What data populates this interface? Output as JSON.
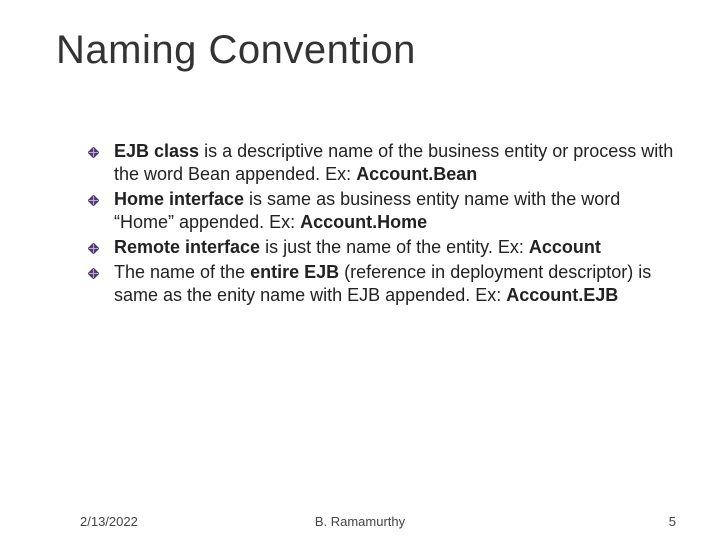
{
  "title": "Naming Convention",
  "bullets": [
    {
      "bold1": "EJB class",
      "text1": " is a descriptive name of the business entity or process with the word Bean appended. Ex: ",
      "bold2": "Account.Bean"
    },
    {
      "bold1": "Home interface",
      "text1": " is same as business entity name with the word “Home” appended. Ex: ",
      "bold2": "Account.Home"
    },
    {
      "bold1": "Remote interface",
      "text1": " is just the name of the entity. Ex: ",
      "bold2": "Account"
    },
    {
      "text0": "The name of the ",
      "bold1": "entire EJB",
      "text1": " (reference in deployment descriptor) is same as the enity name with EJB appended. Ex: ",
      "bold2": "Account.EJB"
    }
  ],
  "footer": {
    "date": "2/13/2022",
    "author": "B. Ramamurthy",
    "page": "5"
  },
  "colors": {
    "bullet_fill": "#5a3a7a",
    "bullet_stroke": "#3a2a5a"
  }
}
